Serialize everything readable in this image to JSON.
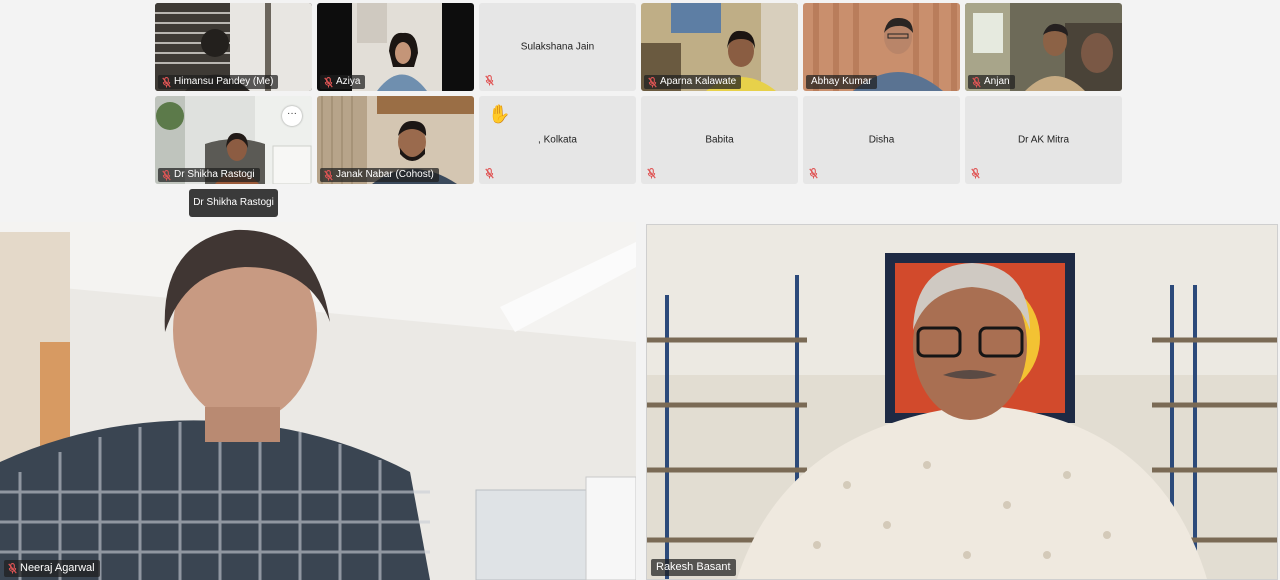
{
  "participants_grid": [
    {
      "name": "Himansu Pandey (Me)",
      "muted": true,
      "video": true
    },
    {
      "name": "Aziya",
      "muted": true,
      "video": true
    },
    {
      "name": "Sulakshana Jain",
      "muted": true,
      "video": false
    },
    {
      "name": "Aparna Kalawate",
      "muted": true,
      "video": true
    },
    {
      "name": "Abhay Kumar",
      "muted": false,
      "video": true
    },
    {
      "name": "Anjan",
      "muted": true,
      "video": true
    },
    {
      "name": "Dr Shikha Rastogi",
      "muted": true,
      "video": true
    },
    {
      "name": "Janak Nabar (Cohost)",
      "muted": true,
      "video": true
    },
    {
      "name": ", Kolkata",
      "muted": true,
      "video": false,
      "hand_raised": true
    },
    {
      "name": "Babita",
      "muted": true,
      "video": false
    },
    {
      "name": "Disha",
      "muted": true,
      "video": false
    },
    {
      "name": "Dr AK Mitra",
      "muted": true,
      "video": false
    }
  ],
  "tooltip": {
    "text": "Dr Shikha Rastogi"
  },
  "more_button": {
    "label": "···"
  },
  "hand_icon": "✋",
  "speakers": [
    {
      "name": "Neeraj Agarwal",
      "muted": true
    },
    {
      "name": "Rakesh Basant",
      "muted": false
    }
  ]
}
